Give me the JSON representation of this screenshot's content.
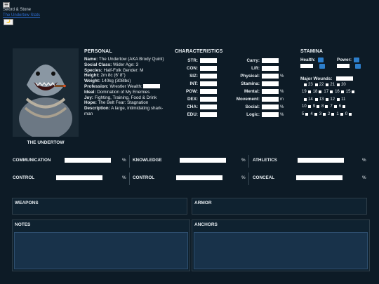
{
  "topbar": {
    "menu_glyph": "☰",
    "title": "Sword & Stone",
    "link": "The Undertow Stats",
    "image_btn_glyph": "🌙"
  },
  "portrait": {
    "caption": "THE UNDERTOW"
  },
  "personal": {
    "title": "PERSONAL",
    "lines": [
      {
        "k": "Name:",
        "v": "The Undertow (AKA Brody Quint)"
      },
      {
        "k": "Social Class:",
        "v": "Wider Age: 3"
      },
      {
        "k": "Species:",
        "v": "Half-Folk Gender: M"
      },
      {
        "k": "Height:",
        "v": "2m 8c (6' 8\")"
      },
      {
        "k": "Weight:",
        "v": "140kg (308lbs)"
      },
      {
        "k": "Profession:",
        "v": "Wrestler Wealth:"
      },
      {
        "k": "Ideal:",
        "v": "Domination of My Enemies"
      },
      {
        "k": "Joy:",
        "v": "Fighting, Training, Food & Drink"
      },
      {
        "k": "Hope:",
        "v": "The Belt Fear: Stagnation"
      },
      {
        "k": "Description:",
        "v": "A large, intimidating shark-man"
      }
    ]
  },
  "characteristics": {
    "title": "CHARACTERISTICS",
    "left": [
      "STR:",
      "CON:",
      "SIZ:",
      "INT:",
      "POW:",
      "DEX:",
      "CHA:",
      "EDU:"
    ],
    "right": [
      {
        "label": "Carry:",
        "unit": ""
      },
      {
        "label": "Lift:",
        "unit": ""
      },
      {
        "label": "Physical:",
        "unit": "%"
      },
      {
        "label": "Stamina:",
        "unit": ""
      },
      {
        "label": "Mental:",
        "unit": "%"
      },
      {
        "label": "Movement:",
        "unit": "m"
      },
      {
        "label": "Social:",
        "unit": "%"
      },
      {
        "label": "Logic:",
        "unit": "%"
      }
    ]
  },
  "stamina": {
    "title": "STAMINA",
    "health_label": "Health:",
    "power_label": "Power:",
    "wounds_label": "Major Wounds:",
    "wounds_rows": [
      [
        "23",
        "22",
        "21",
        "20"
      ],
      [
        "19",
        "18",
        "17",
        "16",
        "15"
      ],
      [
        "14",
        "13",
        "12",
        "11"
      ],
      [
        "10",
        "9",
        "8",
        "7",
        "6"
      ],
      [
        "5",
        "4",
        "3",
        "2",
        "1",
        "0"
      ]
    ]
  },
  "skills": {
    "row1": [
      {
        "label": "COMMUNICATION",
        "unit": "%"
      },
      {
        "label": "KNOWLEDGE",
        "unit": "%"
      },
      {
        "label": "ATHLETICS",
        "unit": "%"
      }
    ],
    "row2": [
      {
        "label": "CONTROL",
        "unit": "%"
      },
      {
        "label": "CONTROL",
        "unit": "%"
      },
      {
        "label": "CONCEAL",
        "unit": "%"
      }
    ]
  },
  "panels": {
    "weapons": "WEAPONS",
    "armor": "ARMOR",
    "notes": "NOTES",
    "anchors": "ANCHORS"
  }
}
